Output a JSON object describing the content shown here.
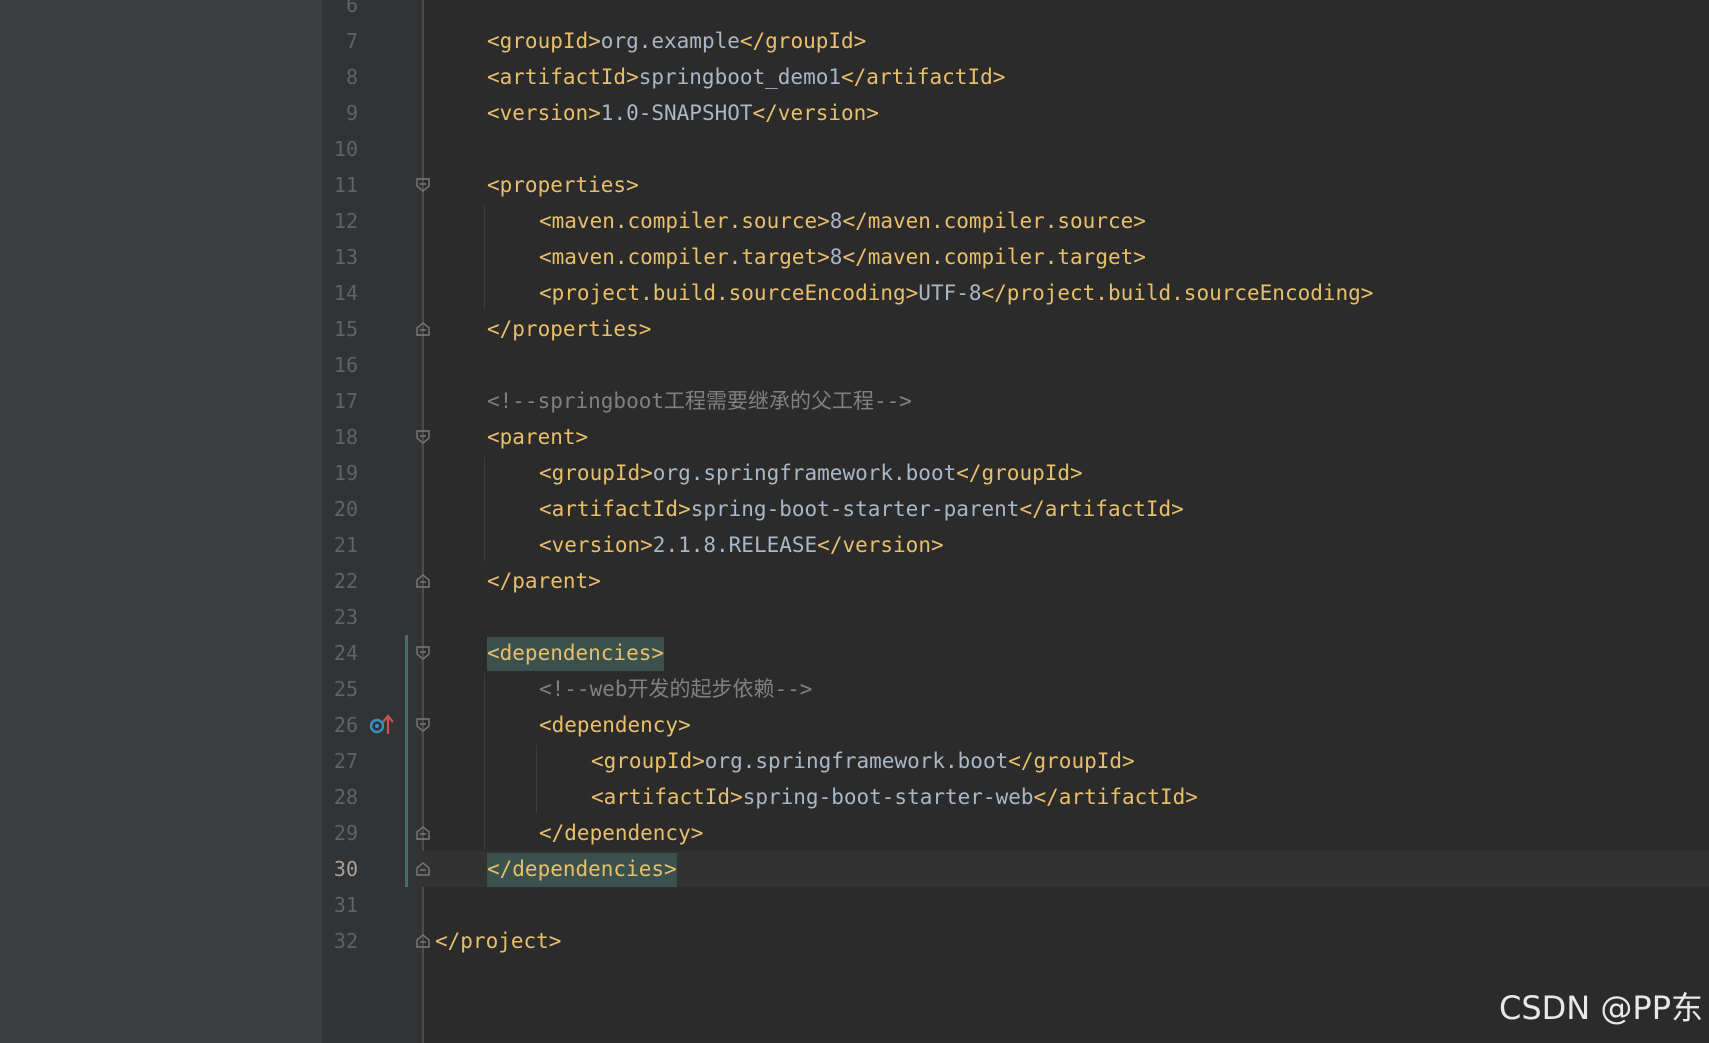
{
  "editor": {
    "lines": [
      {
        "n": "6"
      },
      {
        "n": "7",
        "parts": [
          [
            "tag",
            "<groupId>"
          ],
          [
            "txt",
            "org.example"
          ],
          [
            "tag",
            "</groupId>"
          ]
        ]
      },
      {
        "n": "8",
        "parts": [
          [
            "tag",
            "<artifactId>"
          ],
          [
            "txt",
            "springboot_demo1"
          ],
          [
            "tag",
            "</artifactId>"
          ]
        ]
      },
      {
        "n": "9",
        "parts": [
          [
            "tag",
            "<version>"
          ],
          [
            "txt",
            "1.0-SNAPSHOT"
          ],
          [
            "tag",
            "</version>"
          ]
        ]
      },
      {
        "n": "10"
      },
      {
        "n": "11",
        "parts": [
          [
            "tag",
            "<properties>"
          ]
        ]
      },
      {
        "n": "12",
        "parts": [
          [
            "tag",
            "<maven.compiler.source>"
          ],
          [
            "txt",
            "8"
          ],
          [
            "tag",
            "</maven.compiler.source>"
          ]
        ]
      },
      {
        "n": "13",
        "parts": [
          [
            "tag",
            "<maven.compiler.target>"
          ],
          [
            "txt",
            "8"
          ],
          [
            "tag",
            "</maven.compiler.target>"
          ]
        ]
      },
      {
        "n": "14",
        "parts": [
          [
            "tag",
            "<project.build.sourceEncoding>"
          ],
          [
            "txt",
            "UTF-8"
          ],
          [
            "tag",
            "</project.build.sourceEncoding>"
          ]
        ]
      },
      {
        "n": "15",
        "parts": [
          [
            "tag",
            "</properties>"
          ]
        ]
      },
      {
        "n": "16"
      },
      {
        "n": "17",
        "parts": [
          [
            "cmt",
            "<!--springboot工程需要继承的父工程-->"
          ]
        ]
      },
      {
        "n": "18",
        "parts": [
          [
            "tag",
            "<parent>"
          ]
        ]
      },
      {
        "n": "19",
        "parts": [
          [
            "tag",
            "<groupId>"
          ],
          [
            "txt",
            "org.springframework.boot"
          ],
          [
            "tag",
            "</groupId>"
          ]
        ]
      },
      {
        "n": "20",
        "parts": [
          [
            "tag",
            "<artifactId>"
          ],
          [
            "txt",
            "spring-boot-starter-parent"
          ],
          [
            "tag",
            "</artifactId>"
          ]
        ]
      },
      {
        "n": "21",
        "parts": [
          [
            "tag",
            "<version>"
          ],
          [
            "txt",
            "2.1.8.RELEASE"
          ],
          [
            "tag",
            "</version>"
          ]
        ]
      },
      {
        "n": "22",
        "parts": [
          [
            "tag",
            "</parent>"
          ]
        ]
      },
      {
        "n": "23"
      },
      {
        "n": "24",
        "parts": [
          [
            "hl",
            "<dependencies>"
          ]
        ]
      },
      {
        "n": "25",
        "parts": [
          [
            "cmt",
            "<!--web开发的起步依赖-->"
          ]
        ]
      },
      {
        "n": "26",
        "parts": [
          [
            "tag",
            "<dependency>"
          ]
        ]
      },
      {
        "n": "27",
        "parts": [
          [
            "tag",
            "<groupId>"
          ],
          [
            "txt",
            "org.springframework.boot"
          ],
          [
            "tag",
            "</groupId>"
          ]
        ]
      },
      {
        "n": "28",
        "parts": [
          [
            "tag",
            "<artifactId>"
          ],
          [
            "txt",
            "spring-boot-starter-web"
          ],
          [
            "tag",
            "</artifactId>"
          ]
        ]
      },
      {
        "n": "29",
        "parts": [
          [
            "tag",
            "</dependency>"
          ]
        ]
      },
      {
        "n": "30",
        "parts": [
          [
            "hl",
            "</dependencies>"
          ]
        ]
      },
      {
        "n": "31"
      },
      {
        "n": "32",
        "parts": [
          [
            "tag",
            "</project>"
          ]
        ]
      }
    ]
  },
  "watermark": "CSDN @PP东",
  "colors": {
    "tag": "#e8bf6a",
    "text": "#a9b7c6",
    "comment": "#808080",
    "line_number": "#606366",
    "highlight_bg": "#3b514d",
    "vcs_modified": "#4a6e5c"
  }
}
